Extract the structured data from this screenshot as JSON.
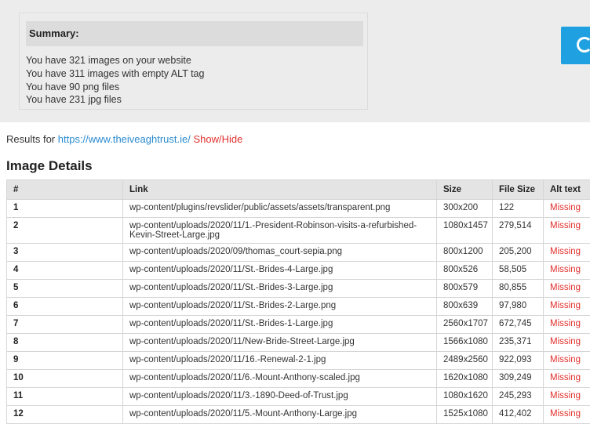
{
  "summary": {
    "title": "Summary:",
    "lines": [
      "You have 321 images on your website",
      "You have 311 images with empty ALT tag",
      "You have 90 png files",
      "You have 231 jpg files"
    ]
  },
  "action": {
    "icon": "refresh-icon",
    "color": "#1fa0e0"
  },
  "results": {
    "prefix": "Results for",
    "url": "https://www.theiveaghtrust.ie/",
    "toggle": "Show/Hide"
  },
  "details": {
    "heading": "Image Details",
    "columns": [
      "#",
      "Link",
      "Size",
      "File Size",
      "Alt text"
    ],
    "rows": [
      {
        "num": "1",
        "link": "wp-content/plugins/revslider/public/assets/assets/transparent.png",
        "size": "300x200",
        "file_size": "122",
        "alt": "Missing"
      },
      {
        "num": "2",
        "link": "wp-content/uploads/2020/11/1.-President-Robinson-visits-a-refurbished-Kevin-Street-Large.jpg",
        "size": "1080x1457",
        "file_size": "279,514",
        "alt": "Missing"
      },
      {
        "num": "3",
        "link": "wp-content/uploads/2020/09/thomas_court-sepia.png",
        "size": "800x1200",
        "file_size": "205,200",
        "alt": "Missing"
      },
      {
        "num": "4",
        "link": "wp-content/uploads/2020/11/St.-Brides-4-Large.jpg",
        "size": "800x526",
        "file_size": "58,505",
        "alt": "Missing"
      },
      {
        "num": "5",
        "link": "wp-content/uploads/2020/11/St.-Brides-3-Large.jpg",
        "size": "800x579",
        "file_size": "80,855",
        "alt": "Missing"
      },
      {
        "num": "6",
        "link": "wp-content/uploads/2020/11/St.-Brides-2-Large.png",
        "size": "800x639",
        "file_size": "97,980",
        "alt": "Missing"
      },
      {
        "num": "7",
        "link": "wp-content/uploads/2020/11/St.-Brides-1-Large.jpg",
        "size": "2560x1707",
        "file_size": "672,745",
        "alt": "Missing"
      },
      {
        "num": "8",
        "link": "wp-content/uploads/2020/11/New-Bride-Street-Large.jpg",
        "size": "1566x1080",
        "file_size": "235,371",
        "alt": "Missing"
      },
      {
        "num": "9",
        "link": "wp-content/uploads/2020/11/16.-Renewal-2-1.jpg",
        "size": "2489x2560",
        "file_size": "922,093",
        "alt": "Missing"
      },
      {
        "num": "10",
        "link": "wp-content/uploads/2020/11/6.-Mount-Anthony-scaled.jpg",
        "size": "1620x1080",
        "file_size": "309,249",
        "alt": "Missing"
      },
      {
        "num": "11",
        "link": "wp-content/uploads/2020/11/3.-1890-Deed-of-Trust.jpg",
        "size": "1080x1620",
        "file_size": "245,293",
        "alt": "Missing"
      },
      {
        "num": "12",
        "link": "wp-content/uploads/2020/11/5.-Mount-Anthony-Large.jpg",
        "size": "1525x1080",
        "file_size": "412,402",
        "alt": "Missing"
      }
    ]
  }
}
